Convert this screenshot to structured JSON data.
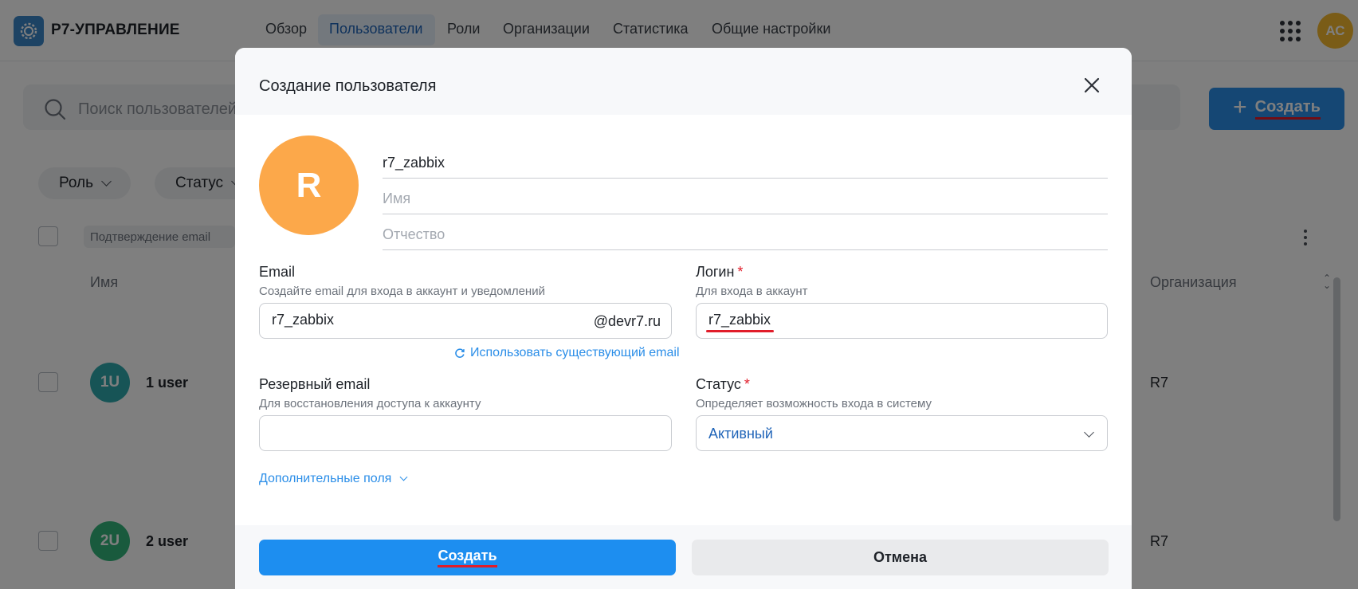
{
  "app": {
    "title": "Р7-УПРАВЛЕНИЕ",
    "user_initials": "АС"
  },
  "nav": {
    "items": [
      {
        "label": "Обзор"
      },
      {
        "label": "Пользователи",
        "active": true
      },
      {
        "label": "Роли"
      },
      {
        "label": "Организации"
      },
      {
        "label": "Статистика"
      },
      {
        "label": "Общие настройки"
      }
    ]
  },
  "page": {
    "search_placeholder": "Поиск пользователей",
    "create_label": "Создать",
    "filters": [
      "Роль",
      "Статус"
    ],
    "email_confirm_chip": "Подтверждение email",
    "columns": {
      "name": "Имя",
      "org": "Организация"
    },
    "rows": [
      {
        "initials": "1U",
        "name": "1 user",
        "org": "R7",
        "color": "#2fa9ad"
      },
      {
        "initials": "2U",
        "name": "2 user",
        "org": "R7",
        "color": "#32b57a"
      }
    ]
  },
  "modal": {
    "title": "Создание пользователя",
    "avatar_letter": "R",
    "avatar_color": "#fca84a",
    "last_name_value": "r7_zabbix",
    "first_name_placeholder": "Имя",
    "middle_name_placeholder": "Отчество",
    "email": {
      "label": "Email",
      "hint": "Создайте email для входа в аккаунт и уведомлений",
      "value": "r7_zabbix",
      "domain": "@devr7.ru",
      "use_existing_link": "Использовать существующий email"
    },
    "login": {
      "label": "Логин",
      "required_mark": "*",
      "hint": "Для входа в аккаунт",
      "value": "r7_zabbix"
    },
    "backup_email": {
      "label": "Резервный email",
      "hint": "Для восстановления доступа к аккаунту",
      "value": ""
    },
    "status": {
      "label": "Статус",
      "required_mark": "*",
      "hint": "Определяет возможность входа в систему",
      "value": "Активный"
    },
    "extra_fields_link": "Дополнительные поля",
    "create_button": "Создать",
    "cancel_button": "Отмена"
  },
  "colors": {
    "accent": "#1d8ef0",
    "annotation": "#e11d2a"
  }
}
